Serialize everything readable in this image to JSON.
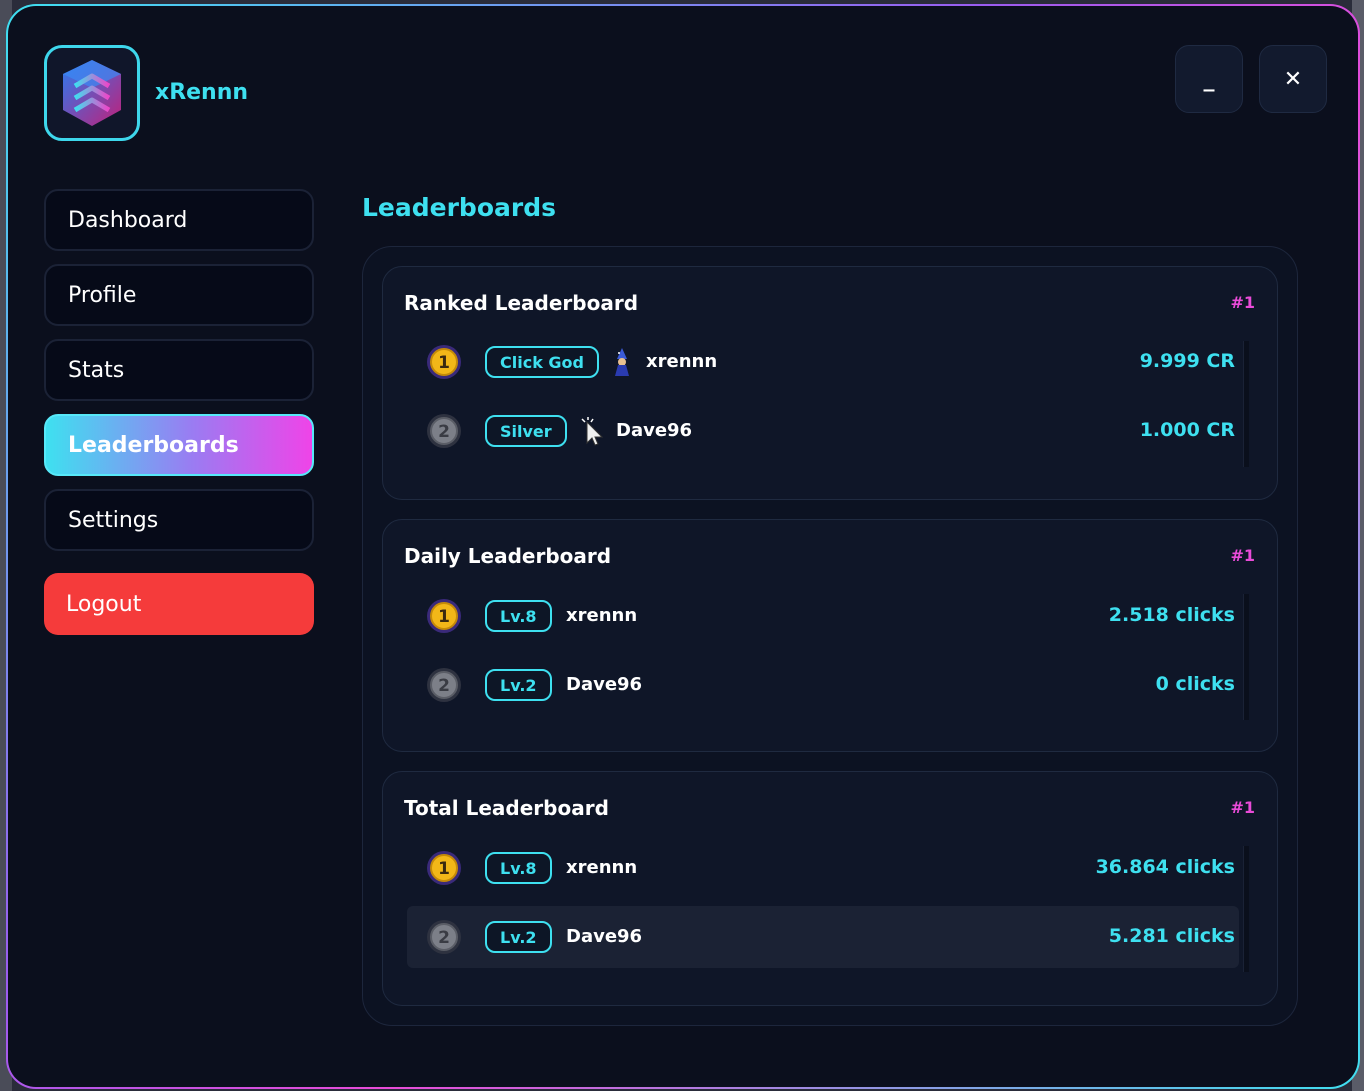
{
  "header": {
    "username": "xRennn",
    "minimize_label": "_",
    "close_label": "✕"
  },
  "sidebar": {
    "items": [
      {
        "label": "Dashboard"
      },
      {
        "label": "Profile"
      },
      {
        "label": "Stats"
      },
      {
        "label": "Leaderboards",
        "active": true
      },
      {
        "label": "Settings"
      }
    ],
    "logout_label": "Logout"
  },
  "main": {
    "title": "Leaderboards",
    "boards": [
      {
        "title": "Ranked Leaderboard",
        "rank": "#1",
        "rows": [
          {
            "place": "1",
            "badge": "Click God",
            "icon": "wizard-icon",
            "player": "xrennn",
            "score": "9.999 CR"
          },
          {
            "place": "2",
            "badge": "Silver",
            "icon": "cursor-icon",
            "player": "Dave96",
            "score": "1.000 CR"
          }
        ]
      },
      {
        "title": "Daily Leaderboard",
        "rank": "#1",
        "rows": [
          {
            "place": "1",
            "badge": "Lv.8",
            "player": "xrennn",
            "score": "2.518 clicks"
          },
          {
            "place": "2",
            "badge": "Lv.2",
            "player": "Dave96",
            "score": "0 clicks"
          }
        ]
      },
      {
        "title": "Total Leaderboard",
        "rank": "#1",
        "rows": [
          {
            "place": "1",
            "badge": "Lv.8",
            "player": "xrennn",
            "score": "36.864 clicks"
          },
          {
            "place": "2",
            "badge": "Lv.2",
            "player": "Dave96",
            "score": "5.281 clicks",
            "highlighted": true
          }
        ]
      }
    ]
  },
  "colors": {
    "accent_cyan": "#3ee0f0",
    "accent_magenta": "#e94bd8",
    "logout_red": "#f53b3b",
    "background": "#0b0f1d"
  }
}
